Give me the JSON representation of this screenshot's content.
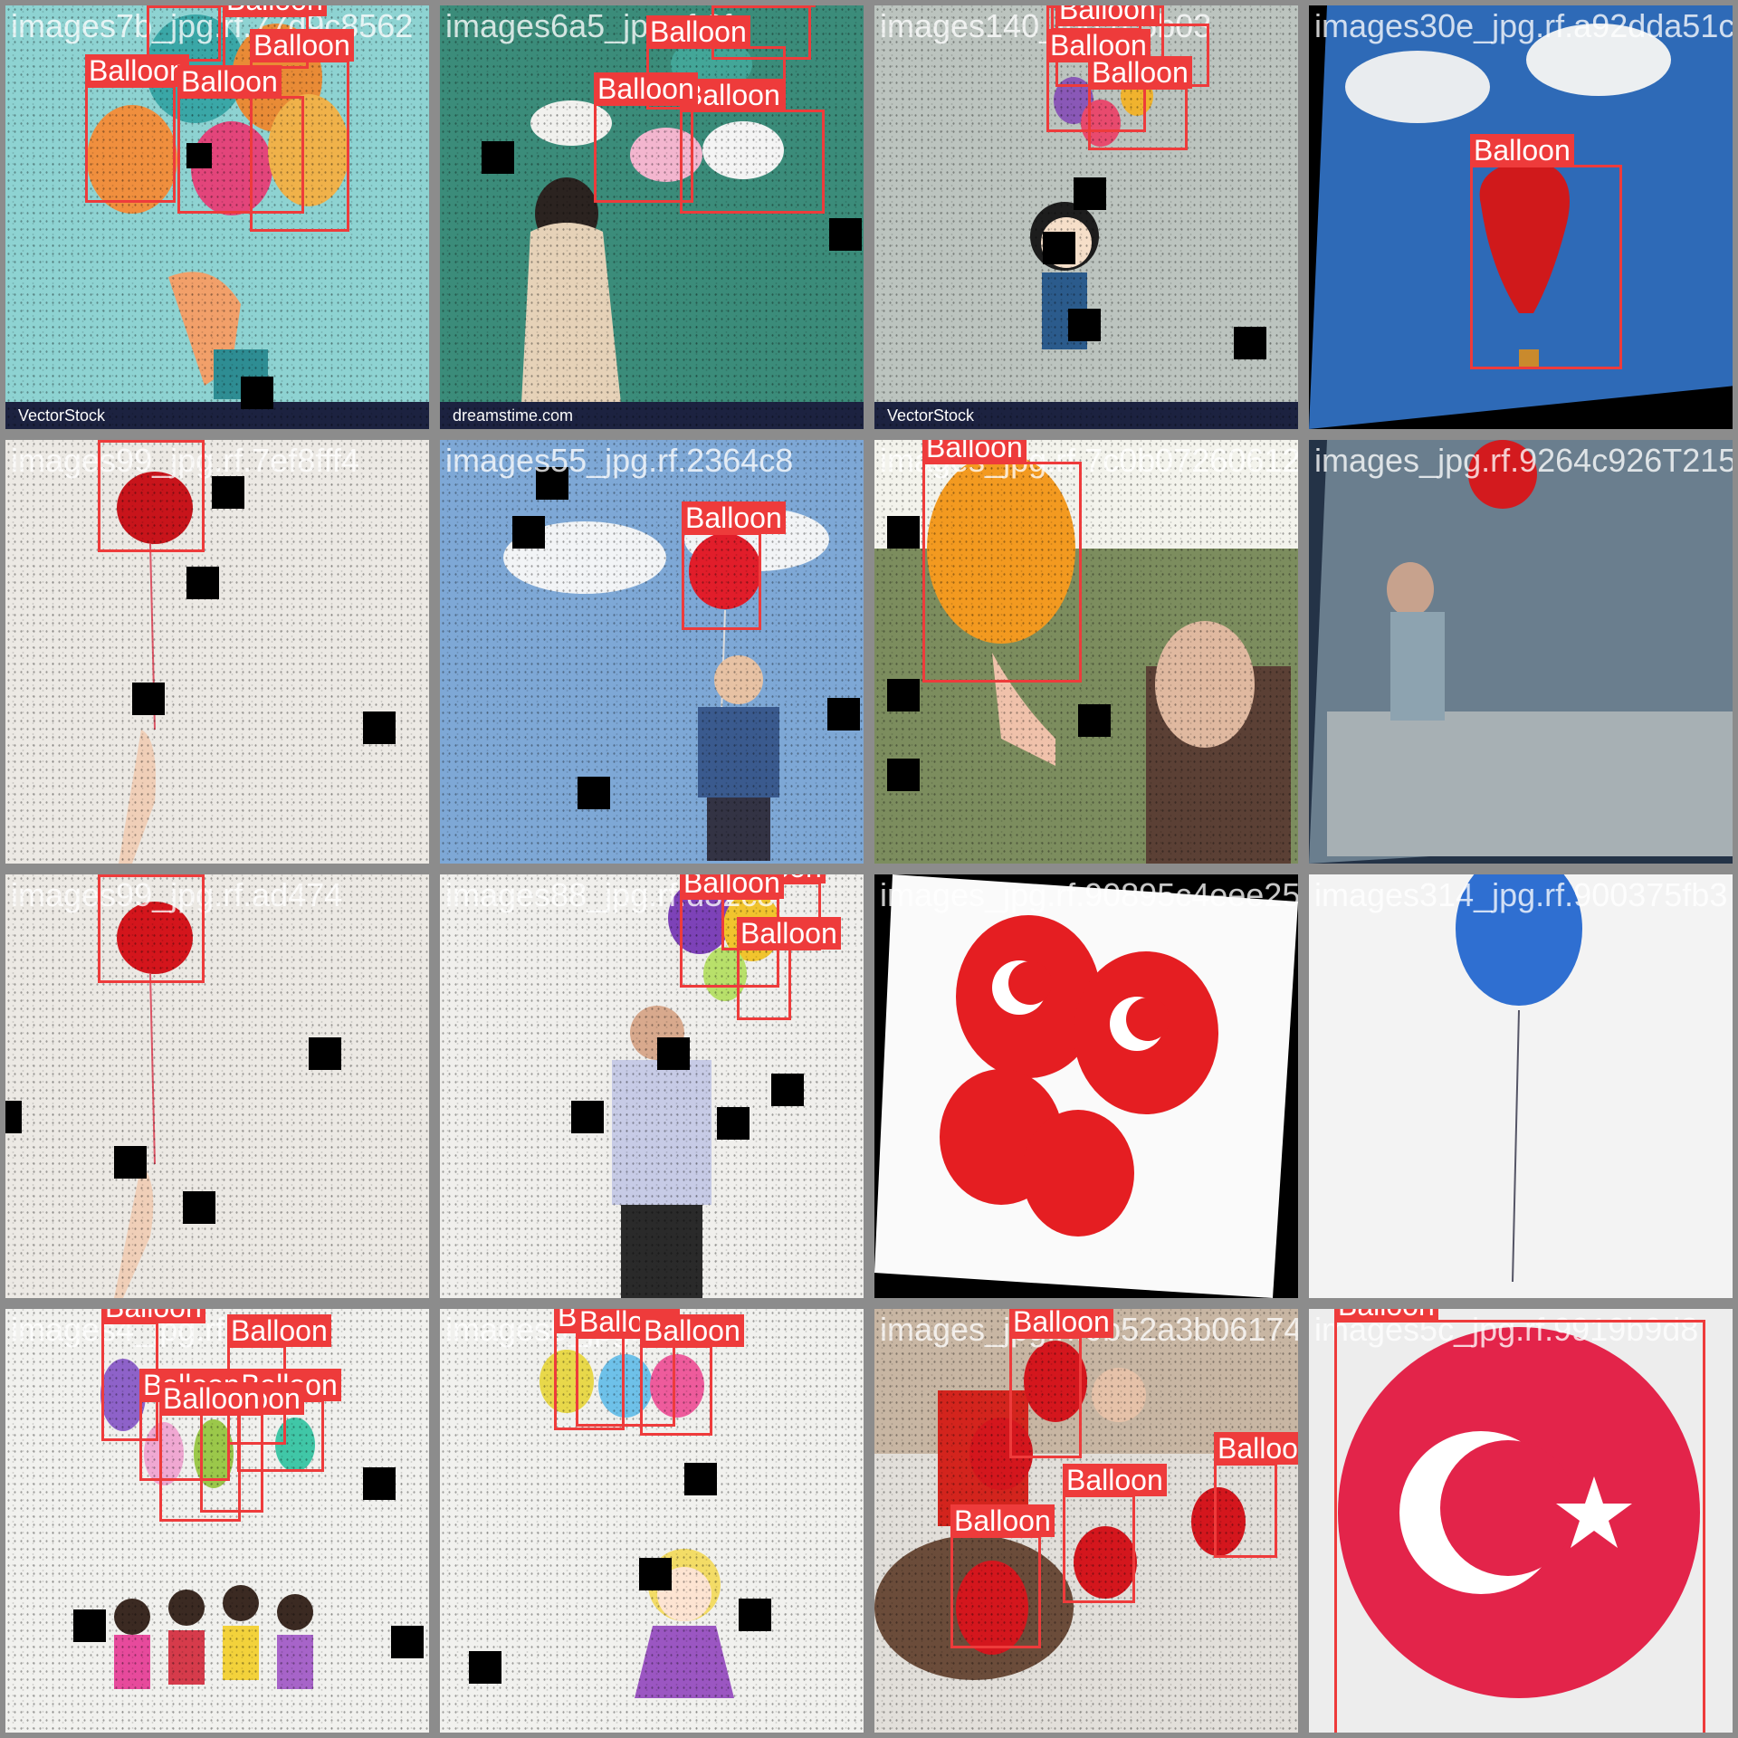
{
  "label": "Balloon",
  "colors": {
    "box": "#ee3b3b",
    "background": "#8c8c8c"
  },
  "tiles": [
    {
      "filename": "images7b_jpg.rf.77d9c8562",
      "watermark": "VectorStock"
    },
    {
      "filename": "images6a5_jpg.rf.6fc",
      "watermark": "dreamstime.com"
    },
    {
      "filename": "images140_jpg.rf.5b03",
      "watermark": "VectorStock"
    },
    {
      "filename": "images30e_jpg.rf.a92dda51c3",
      "watermark": ""
    },
    {
      "filename": "images99_jpg.rf.7ef8fff4",
      "watermark": ""
    },
    {
      "filename": "images55_jpg.rf.2364c8",
      "watermark": ""
    },
    {
      "filename": "images_jpg.rf.7c0b07260612",
      "watermark": ""
    },
    {
      "filename": "images_jpg.rf.9264c926T215201",
      "watermark": ""
    },
    {
      "filename": "images99_jpg.rf.ad474",
      "watermark": ""
    },
    {
      "filename": "images88_jpg.rf.d32c3",
      "watermark": ""
    },
    {
      "filename": "images_jpg.rf.90895c4eee2534d0b8",
      "watermark": ""
    },
    {
      "filename": "images314_jpg.rf.900375fb3",
      "watermark": ""
    },
    {
      "filename": "images4_jpg.rf.05674f",
      "watermark": ""
    },
    {
      "filename": "images0_jpg.rf.9b2d",
      "watermark": ""
    },
    {
      "filename": "images_jpg.rf.0b52a3b0617436",
      "watermark": ""
    },
    {
      "filename": "images5c_jpg.rf.9919b9d8",
      "watermark": ""
    }
  ]
}
